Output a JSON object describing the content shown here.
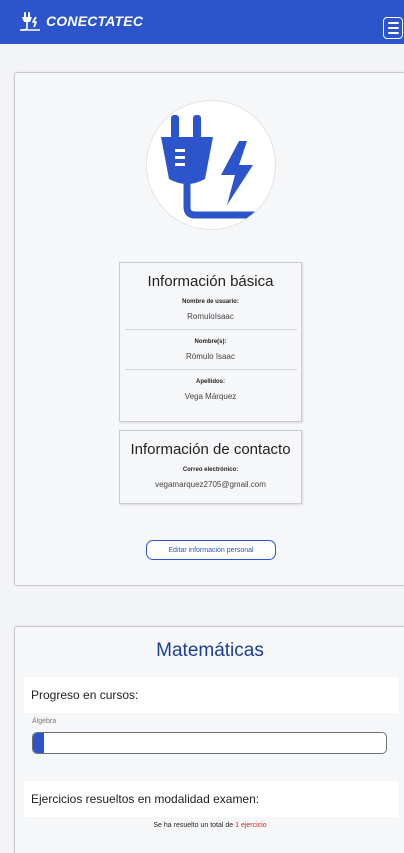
{
  "navbar": {
    "brand": "CONECTATEC",
    "icon": "plug-icon",
    "menu_icon": "hamburger-icon",
    "bg_color": "#2c55cc"
  },
  "profile": {
    "avatar_icon": "electric-plug-icon",
    "basic": {
      "title": "Información básica",
      "username_label": "Nombre de usuario:",
      "username": "RomuloIsaac",
      "names_label": "Nombre(s):",
      "names": "Rómulo Isaac",
      "surnames_label": "Apellidos:",
      "surnames": "Vega Márquez"
    },
    "contact": {
      "title": "Información de contacto",
      "email_label": "Correo electrónico:",
      "email": "vegamarquez2705@gmail.com"
    },
    "edit_button": "Editar información personal"
  },
  "math": {
    "title": "Matemáticas",
    "progress_header": "Progreso en cursos:",
    "courses": [
      {
        "name": "Álgebra",
        "progress": 0.03
      }
    ],
    "exam_header": "Ejercicios resueltos en modalidad examen:",
    "summary_prefix": "Se ha resuelto un total de ",
    "summary_link": "1 ejercicio",
    "accent_color": "#1c3f94",
    "link_color": "#dd2222"
  }
}
